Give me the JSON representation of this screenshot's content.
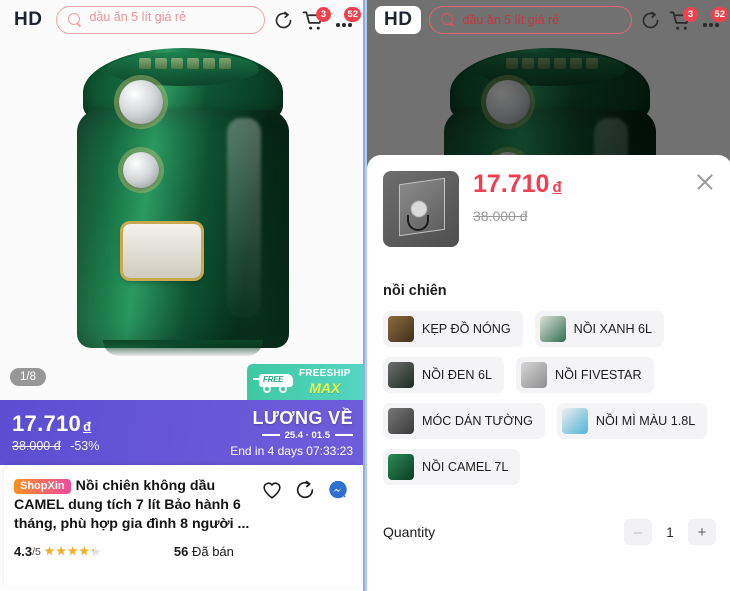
{
  "topbar": {
    "hd_label": "HD",
    "search_value": "dầu ăn 5 lít giá rẻ",
    "search_placeholder": "dầu ăn 5 lít giá rẻ",
    "search_icon": "search-icon",
    "refresh_icon": "refresh-icon",
    "cart_icon": "cart-icon",
    "cart_badge": "3",
    "more_icon": "more-dots-icon",
    "more_badge": "52"
  },
  "hero": {
    "image_counter": "1/8",
    "freeship": {
      "free_tag": "FREE",
      "line1": "FREESHIP",
      "line2": "MAX"
    }
  },
  "price_banner": {
    "price": "17.710",
    "currency": "đ",
    "original_price": "38.000 đ",
    "discount": "-53%",
    "campaign": "LƯƠNG VỀ",
    "dates": "25.4 · 01.5",
    "countdown": "End in 4 days 07:33:23"
  },
  "product_card": {
    "shop_badge": "ShopXin",
    "title": "Nồi chiên không dầu CAMEL dung tích 7 lít Bảo hành 6 tháng, phù hợp gia đình 8 người ...",
    "favorite_icon": "heart-icon",
    "share_icon": "share-refresh-icon",
    "chat_icon": "messenger-chat-icon",
    "rating_value": "4.3",
    "rating_max": "/5",
    "stars_filled": "★★★★★",
    "sold_count": "56",
    "sold_label": "Đã bán"
  },
  "sheet": {
    "close_icon": "close-icon",
    "thumb_name": "variant-thumbnail",
    "price": "17.710",
    "currency": "đ",
    "original_price": "38.000 đ",
    "variant_group_label": "nồi chiên",
    "variants": [
      {
        "name": "KẸP ĐỒ NÓNG",
        "color": "#6b5a44"
      },
      {
        "name": "NỒI XANH 6L",
        "color": "#2f6f52"
      },
      {
        "name": "NỒI ĐEN 6L",
        "color": "#23402f"
      },
      {
        "name": "NỒI FIVESTAR",
        "color": "#8d8d8d"
      },
      {
        "name": "MÓC DÁN TƯỜNG",
        "color": "#5c5c5c"
      },
      {
        "name": "NỒI MÌ MÀU 1.8L",
        "color": "#4fb4d8"
      },
      {
        "name": "NỒI CAMEL 7L",
        "color": "#124a2c"
      }
    ],
    "quantity_label": "Quantity",
    "quantity_value": "1",
    "minus_label": "–",
    "plus_label": "+"
  },
  "colors": {
    "accent_red": "#ee4055",
    "banner_purple": "#6a58d8",
    "freeship_green": "#3ec9a2",
    "star_gold": "#f2b01e"
  }
}
